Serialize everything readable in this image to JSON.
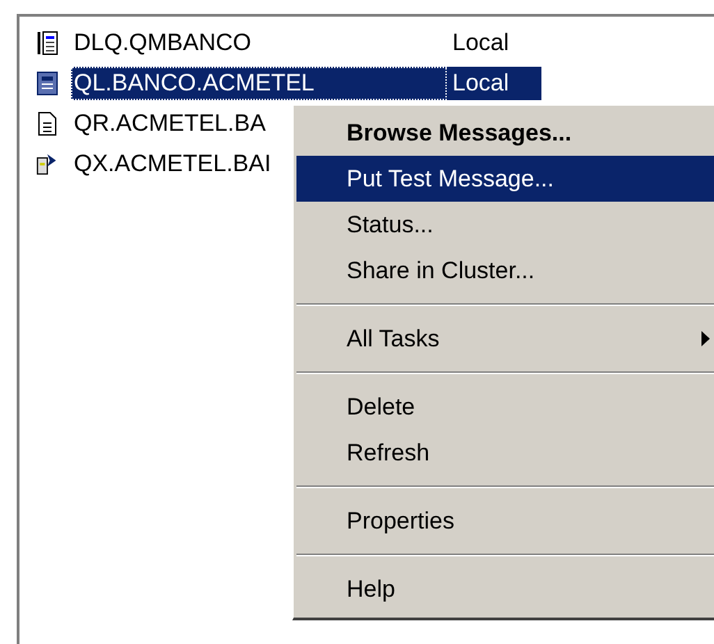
{
  "queues": [
    {
      "name": "DLQ.QMBANCO",
      "location": "Local",
      "kind": "dead-letter",
      "selected": false
    },
    {
      "name": "QL.BANCO.ACMETEL",
      "location": "Local",
      "kind": "local",
      "selected": true
    },
    {
      "name": "QR.ACMETEL.BA",
      "kind": "remote",
      "selected": false
    },
    {
      "name": "QX.ACMETEL.BAI",
      "kind": "transmission",
      "selected": false
    }
  ],
  "context_menu": [
    {
      "kind": "item",
      "label": "Browse Messages...",
      "default": true,
      "selected": false
    },
    {
      "kind": "item",
      "label": "Put Test Message...",
      "default": false,
      "selected": true
    },
    {
      "kind": "item",
      "label": "Status...",
      "default": false,
      "selected": false
    },
    {
      "kind": "item",
      "label": "Share in Cluster...",
      "default": false,
      "selected": false
    },
    {
      "kind": "separator"
    },
    {
      "kind": "submenu",
      "label": "All Tasks",
      "default": false,
      "selected": false
    },
    {
      "kind": "separator"
    },
    {
      "kind": "item",
      "label": "Delete",
      "default": false,
      "selected": false
    },
    {
      "kind": "item",
      "label": "Refresh",
      "default": false,
      "selected": false
    },
    {
      "kind": "separator"
    },
    {
      "kind": "item",
      "label": "Properties",
      "default": false,
      "selected": false
    },
    {
      "kind": "separator"
    },
    {
      "kind": "item",
      "label": "Help",
      "default": false,
      "selected": false
    }
  ]
}
